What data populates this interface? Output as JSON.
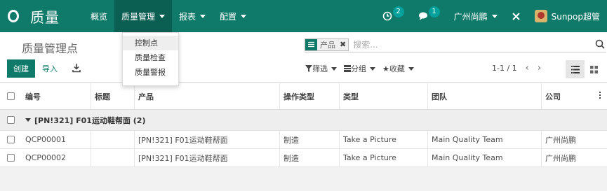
{
  "app": {
    "name": "质量",
    "menu": [
      {
        "label": "概览",
        "has_caret": false
      },
      {
        "label": "质量管理",
        "has_caret": true
      },
      {
        "label": "报表",
        "has_caret": true
      },
      {
        "label": "配置",
        "has_caret": true
      }
    ],
    "activity_count": "2",
    "message_count": "1",
    "company": "广州尚鹏",
    "user": "Sunpop超管"
  },
  "dropdown": {
    "items": [
      "控制点",
      "质量检查",
      "质量警报"
    ]
  },
  "control_panel": {
    "breadcrumb": "质量管理点",
    "create_label": "创建",
    "import_label": "导入",
    "facet_label": "产品",
    "search_placeholder": "搜索...",
    "filters_label": "筛选",
    "groupby_label": "分组",
    "favorites_label": "收藏",
    "pager": "1-1 / 1"
  },
  "table": {
    "columns": [
      "编号",
      "标题",
      "产品",
      "操作类型",
      "类型",
      "团队",
      "公司"
    ],
    "group_label": "[PN!321] F01运动鞋帮面 (2)",
    "rows": [
      {
        "ref": "QCP00001",
        "title": "",
        "product": "[PN!321] F01运动鞋帮面",
        "operation": "制造",
        "type": "Take a Picture",
        "team": "Main Quality Team",
        "company": "广州尚鹏"
      },
      {
        "ref": "QCP00002",
        "title": "",
        "product": "[PN!321] F01运动鞋帮面",
        "operation": "制造",
        "type": "Take a Picture",
        "team": "Main Quality Team",
        "company": "广州尚鹏"
      }
    ]
  },
  "colors": {
    "brand": "#107a6a",
    "brand_dark": "#0b5f52",
    "badge": "#00a09d"
  }
}
